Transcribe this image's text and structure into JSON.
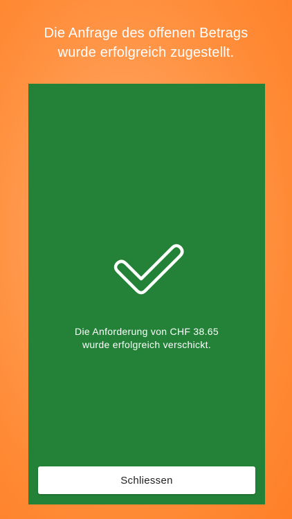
{
  "header": {
    "line1": "Die Anfrage des offenen Betrags",
    "line2": "wurde erfolgreich zugestellt."
  },
  "card": {
    "icon": "checkmark-icon",
    "message_line1": "Die Anforderung von CHF 38.65",
    "message_line2": "wurde erfolgreich verschickt.",
    "close_label": "Schliessen"
  },
  "colors": {
    "background": "#ff9a4f",
    "card": "#238238",
    "button": "#ffffff"
  }
}
